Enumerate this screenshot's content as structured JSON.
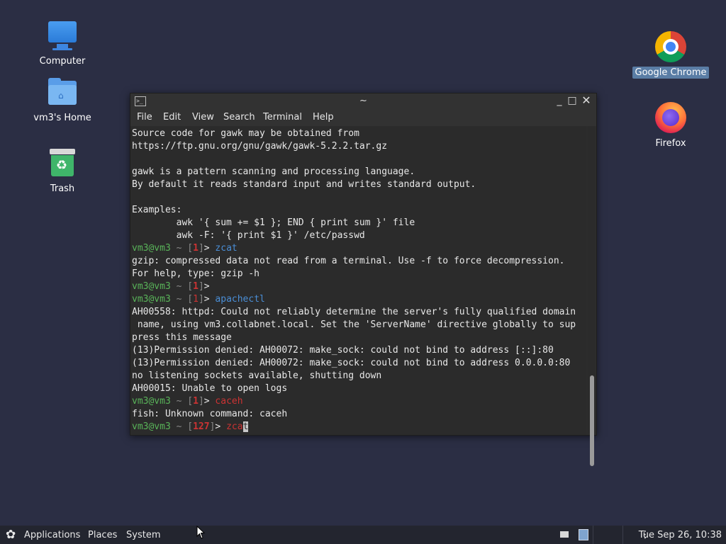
{
  "desktop": {
    "icons": [
      {
        "label": "Computer",
        "icon": "computer-icon"
      },
      {
        "label": "vm3's Home",
        "icon": "home-folder-icon"
      },
      {
        "label": "Trash",
        "icon": "trash-icon"
      },
      {
        "label": "Google Chrome",
        "icon": "chrome-icon",
        "selected": true
      },
      {
        "label": "Firefox",
        "icon": "firefox-icon"
      }
    ]
  },
  "terminal": {
    "title": "~",
    "menu": [
      "File",
      "Edit",
      "View",
      "Search",
      "Terminal",
      "Help"
    ],
    "prompt": {
      "user": "vm3@vm3",
      "path": "~"
    },
    "output_lines": {
      "l1": "Source code for gawk may be obtained from",
      "l2": "https://ftp.gnu.org/gnu/gawk/gawk-5.2.2.tar.gz",
      "l3": "gawk is a pattern scanning and processing language.",
      "l4": "By default it reads standard input and writes standard output.",
      "l5": "Examples:",
      "l6": "        awk '{ sum += $1 }; END { print sum }' file",
      "l7": "        awk -F: '{ print $1 }' /etc/passwd",
      "l9": "gzip: compressed data not read from a terminal. Use -f to force decompression.",
      "l10": "For help, type: gzip -h",
      "l13": "AH00558: httpd: Could not reliably determine the server's fully qualified domain",
      "l14": " name, using vm3.collabnet.local. Set the 'ServerName' directive globally to sup",
      "l15": "press this message",
      "l16": "(13)Permission denied: AH00072: make_sock: could not bind to address [::]:80",
      "l17": "(13)Permission denied: AH00072: make_sock: could not bind to address 0.0.0.0:80",
      "l18": "no listening sockets available, shutting down",
      "l19": "AH00015: Unable to open logs",
      "l21": "fish: Unknown command: caceh"
    },
    "prompts": {
      "p8": {
        "status": "1",
        "cmd": "zcat"
      },
      "p11": {
        "status": "1",
        "cmd": ""
      },
      "p12": {
        "status": "1",
        "cmd": "apachectl"
      },
      "p20": {
        "status": "1",
        "cmd": "caceh"
      },
      "p22": {
        "status": "127",
        "cmd_typed": "zca",
        "cursor_char": "t"
      }
    }
  },
  "taskbar": {
    "applications": "Applications",
    "places": "Places",
    "system": "System",
    "clock": "Tue Sep 26, 10:38"
  }
}
